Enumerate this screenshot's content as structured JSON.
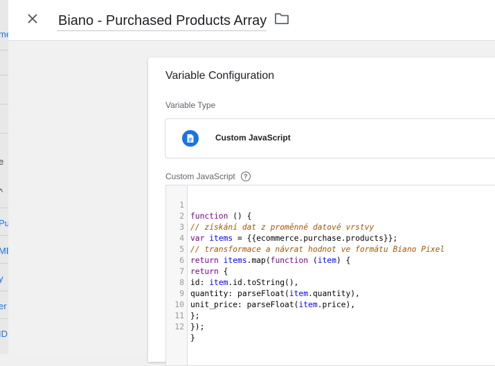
{
  "header": {
    "title": "Biano - Purchased Products Array"
  },
  "background_fragments": [
    "me",
    "e",
    "Pu",
    "ME",
    "y",
    "er",
    "ID"
  ],
  "panel": {
    "title": "Variable Configuration",
    "variable_type_label": "Variable Type",
    "variable_type": "Custom JavaScript",
    "custom_js_label": "Custom JavaScript"
  },
  "editor": {
    "line_numbers": [
      "1",
      "2",
      "3",
      "4",
      "5",
      "6",
      "7",
      "8",
      "9",
      "10",
      "11",
      "12"
    ]
  },
  "colors": {
    "accent": "#1a73e8",
    "keyword": "#770088",
    "comment": "#aa5500",
    "variable": "#0000ff"
  }
}
